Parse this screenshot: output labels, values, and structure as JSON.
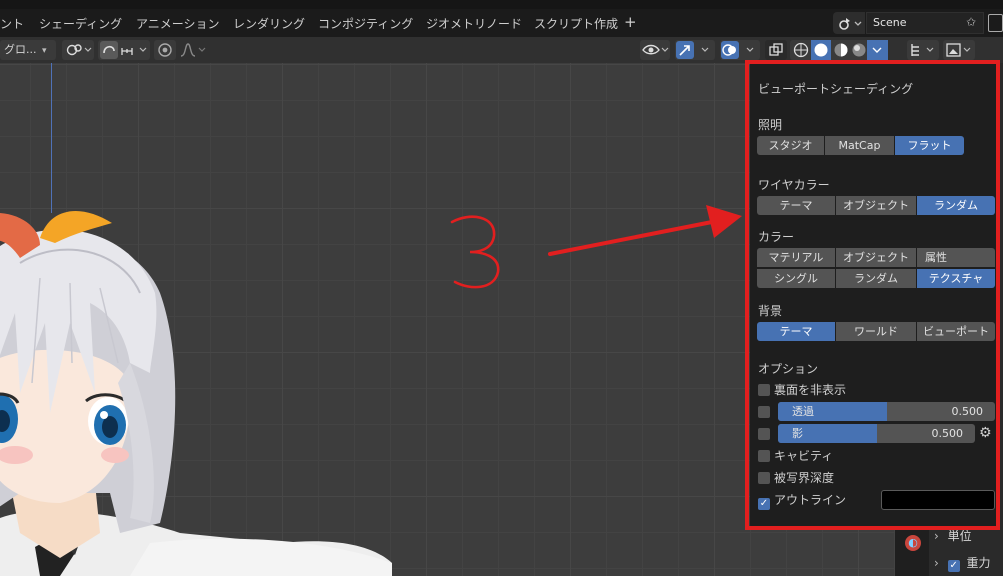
{
  "workspace_tabs": [
    "ント",
    "シェーディング",
    "アニメーション",
    "レンダリング",
    "コンポジティング",
    "ジオメトリノード",
    "スクリプト作成"
  ],
  "workspace_add": "+",
  "scene_name": "Scene",
  "header": {
    "transform_orientation": "グロ...",
    "dropdown_glyph": "▾"
  },
  "popover": {
    "title": "ビューポートシェーディング",
    "lighting": {
      "label": "照明",
      "options": [
        "スタジオ",
        "MatCap",
        "フラット"
      ],
      "selected": "フラット"
    },
    "wire_color": {
      "label": "ワイヤカラー",
      "options": [
        "テーマ",
        "オブジェクト",
        "ランダム"
      ],
      "selected": "ランダム"
    },
    "color": {
      "label": "カラー",
      "options": [
        "マテリアル",
        "オブジェクト",
        "属性",
        "シングル",
        "ランダム",
        "テクスチャ"
      ],
      "selected": "テクスチャ"
    },
    "background": {
      "label": "背景",
      "options": [
        "テーマ",
        "ワールド",
        "ビューポート"
      ],
      "selected": "テーマ"
    },
    "options": {
      "label": "オプション",
      "backface_culling": "裏面を非表示",
      "xray": {
        "label": "透過",
        "value": "0.500",
        "fraction": 0.5
      },
      "shadow": {
        "label": "影",
        "value": "0.500",
        "fraction": 0.5
      },
      "cavity": "キャビティ",
      "depth_of_field": "被写界深度",
      "outline": "アウトライン",
      "outline_checked": true,
      "outline_color": "#000000"
    }
  },
  "props": {
    "units": "単位",
    "gravity": "重力",
    "gravity_checked": true
  },
  "annotation": {
    "number": "3",
    "color": "#e21f1f"
  },
  "colors": {
    "accent": "#4772b3",
    "panel": "#1e1e1e",
    "button": "#545454"
  },
  "glyphs": {
    "check": "✓",
    "chevron": "›",
    "gear": "⚙",
    "pin": "✩"
  }
}
